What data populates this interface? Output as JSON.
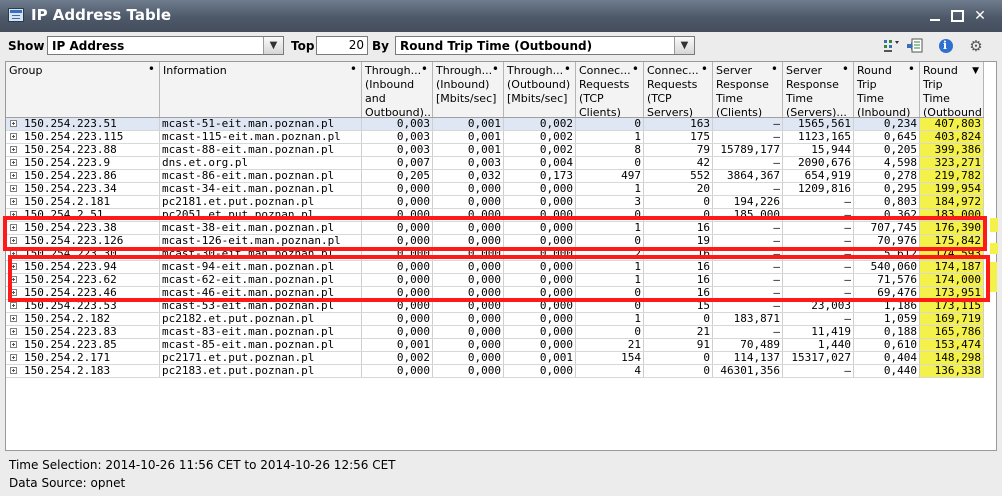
{
  "window": {
    "title": "IP Address Table"
  },
  "toolbar": {
    "show_label": "Show",
    "show_value": "IP Address",
    "top_label": "Top",
    "top_value": "20",
    "by_label": "By",
    "by_value": "Round Trip Time (Outbound)",
    "icons": [
      "column-chooser-icon",
      "export-icon",
      "info-icon",
      "settings-icon"
    ],
    "info_glyph": "i",
    "settings_glyph": "⚙"
  },
  "columns": [
    {
      "label": "Group"
    },
    {
      "label": "Information"
    },
    {
      "label": "Through... (Inbound and Outbound)..."
    },
    {
      "label": "Through... (Inbound) [Mbits/sec]"
    },
    {
      "label": "Through... (Outbound) [Mbits/sec]"
    },
    {
      "label": "Connec... Requests (TCP Clients) [#]"
    },
    {
      "label": "Connec... Requests (TCP Servers) [#]"
    },
    {
      "label": "Server Response Time (Clients) [msec]"
    },
    {
      "label": "Server Response Time (Servers)... [msec]"
    },
    {
      "label": "Round Trip Time (Inbound) [msec]"
    },
    {
      "label": "Round Trip Time (Outbound) [msec]"
    }
  ],
  "rows": [
    {
      "cells": [
        "150.254.223.51",
        "mcast-51-eit.man.poznan.pl",
        "0,003",
        "0,001",
        "0,002",
        "0",
        "163",
        "–",
        "1565,561",
        "0,234",
        "407,803"
      ]
    },
    {
      "cells": [
        "150.254.223.115",
        "mcast-115-eit.man.poznan.pl",
        "0,003",
        "0,001",
        "0,002",
        "1",
        "175",
        "–",
        "1123,165",
        "0,645",
        "403,824"
      ]
    },
    {
      "cells": [
        "150.254.223.88",
        "mcast-88-eit.man.poznan.pl",
        "0,003",
        "0,001",
        "0,002",
        "8",
        "79",
        "15789,177",
        "15,944",
        "0,205",
        "399,386"
      ]
    },
    {
      "cells": [
        "150.254.223.9",
        "dns.et.org.pl",
        "0,007",
        "0,003",
        "0,004",
        "0",
        "42",
        "–",
        "2090,676",
        "4,598",
        "323,271"
      ]
    },
    {
      "cells": [
        "150.254.223.86",
        "mcast-86-eit.man.poznan.pl",
        "0,205",
        "0,032",
        "0,173",
        "497",
        "552",
        "3864,367",
        "654,919",
        "0,278",
        "219,782"
      ]
    },
    {
      "cells": [
        "150.254.223.34",
        "mcast-34-eit.man.poznan.pl",
        "0,000",
        "0,000",
        "0,000",
        "1",
        "20",
        "–",
        "1209,816",
        "0,295",
        "199,954"
      ]
    },
    {
      "cells": [
        "150.254.2.181",
        "pc2181.et.put.poznan.pl",
        "0,000",
        "0,000",
        "0,000",
        "3",
        "0",
        "194,226",
        "–",
        "0,803",
        "184,972"
      ]
    },
    {
      "cells": [
        "150.254.2.51",
        "pc2051.et.put.poznan.pl",
        "0,000",
        "0,000",
        "0,000",
        "0",
        "0",
        "185,000",
        "–",
        "0,362",
        "183,000"
      ]
    },
    {
      "cells": [
        "150.254.223.38",
        "mcast-38-eit.man.poznan.pl",
        "0,000",
        "0,000",
        "0,000",
        "1",
        "16",
        "–",
        "–",
        "707,745",
        "176,390"
      ]
    },
    {
      "cells": [
        "150.254.223.126",
        "mcast-126-eit.man.poznan.pl",
        "0,000",
        "0,000",
        "0,000",
        "0",
        "19",
        "–",
        "–",
        "70,976",
        "175,842"
      ]
    },
    {
      "cells": [
        "150.254.223.30",
        "mcast-30-eit.man.poznan.pl",
        "0,000",
        "0,000",
        "0,000",
        "2",
        "16",
        "–",
        "–",
        "5,612",
        "174,593"
      ]
    },
    {
      "cells": [
        "150.254.223.94",
        "mcast-94-eit.man.poznan.pl",
        "0,000",
        "0,000",
        "0,000",
        "1",
        "16",
        "–",
        "–",
        "540,060",
        "174,187"
      ]
    },
    {
      "cells": [
        "150.254.223.62",
        "mcast-62-eit.man.poznan.pl",
        "0,000",
        "0,000",
        "0,000",
        "1",
        "16",
        "–",
        "–",
        "71,576",
        "174,000"
      ]
    },
    {
      "cells": [
        "150.254.223.46",
        "mcast-46-eit.man.poznan.pl",
        "0,000",
        "0,000",
        "0,000",
        "0",
        "16",
        "–",
        "–",
        "69,476",
        "173,951"
      ]
    },
    {
      "cells": [
        "150.254.223.53",
        "mcast-53-eit.man.poznan.pl",
        "0,000",
        "0,000",
        "0,000",
        "0",
        "15",
        "–",
        "23,003",
        "1,186",
        "173,115"
      ]
    },
    {
      "cells": [
        "150.254.2.182",
        "pc2182.et.put.poznan.pl",
        "0,000",
        "0,000",
        "0,000",
        "1",
        "0",
        "183,871",
        "–",
        "1,059",
        "169,719"
      ]
    },
    {
      "cells": [
        "150.254.223.83",
        "mcast-83-eit.man.poznan.pl",
        "0,000",
        "0,000",
        "0,000",
        "0",
        "21",
        "–",
        "11,419",
        "0,188",
        "165,786"
      ]
    },
    {
      "cells": [
        "150.254.223.85",
        "mcast-85-eit.man.poznan.pl",
        "0,001",
        "0,000",
        "0,000",
        "21",
        "91",
        "70,489",
        "1,440",
        "0,610",
        "153,474"
      ]
    },
    {
      "cells": [
        "150.254.2.171",
        "pc2171.et.put.poznan.pl",
        "0,002",
        "0,000",
        "0,001",
        "154",
        "0",
        "114,137",
        "15317,027",
        "0,404",
        "148,298"
      ]
    },
    {
      "cells": [
        "150.254.2.183",
        "pc2183.et.put.poznan.pl",
        "0,000",
        "0,000",
        "0,000",
        "4",
        "0",
        "46301,356",
        "–",
        "0,440",
        "136,338"
      ]
    }
  ],
  "footer": {
    "time_selection": "Time Selection: 2014-10-26 11:56 CET to 2014-10-26 12:56 CET",
    "data_source": "Data Source: opnet"
  },
  "annotation_colors": {
    "red_box": "#ff1a1a",
    "highlight": "#f4f14a"
  }
}
